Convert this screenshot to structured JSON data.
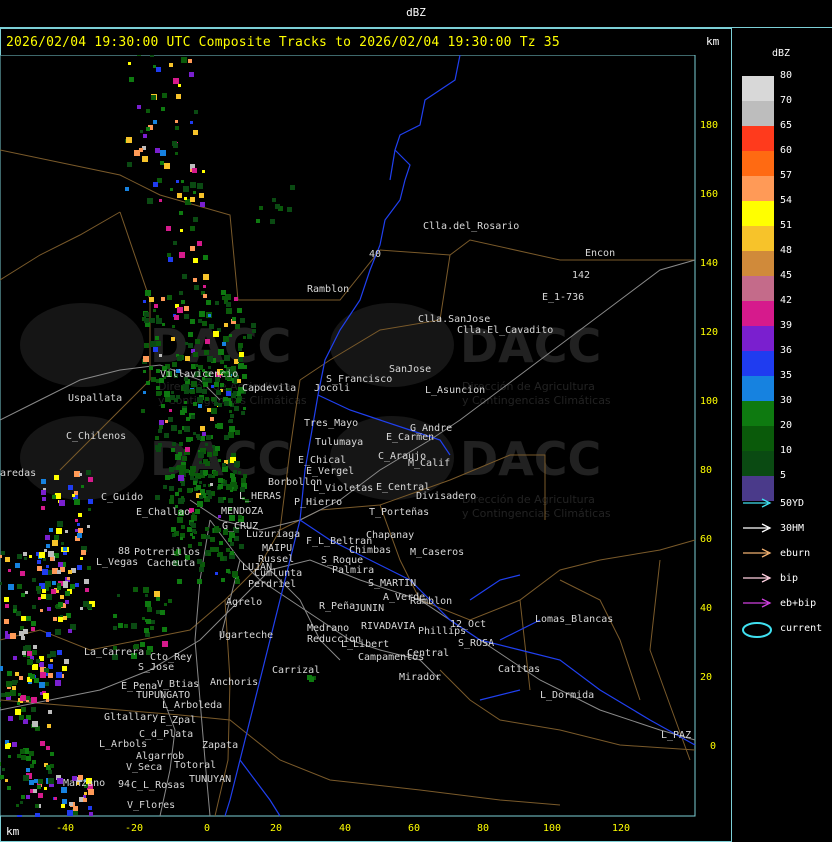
{
  "window": {
    "title": "dBZ"
  },
  "header": {
    "text": "2026/02/04 19:30:00 UTC Composite Tracks to 2026/02/04 19:30:00 Tz 35",
    "km_right": "km",
    "km_bottom": "km"
  },
  "axes": {
    "y_ticks": [
      "180",
      "160",
      "140",
      "120",
      "100",
      "80",
      "60",
      "40",
      "20",
      "0"
    ],
    "x_ticks": [
      "-40",
      "-20",
      "0",
      "20",
      "40",
      "60",
      "80",
      "100",
      "120"
    ]
  },
  "legend": {
    "title": "dBZ",
    "levels": [
      {
        "label": "80",
        "color": "#d8d8d8"
      },
      {
        "label": "70",
        "color": "#bdbdbd"
      },
      {
        "label": "65",
        "color": "#ff3a1c"
      },
      {
        "label": "60",
        "color": "#ff6a12"
      },
      {
        "label": "57",
        "color": "#ff9a57"
      },
      {
        "label": "54",
        "color": "#ffff00"
      },
      {
        "label": "51",
        "color": "#f7c32a"
      },
      {
        "label": "48",
        "color": "#d08a3a"
      },
      {
        "label": "45",
        "color": "#c46b8a"
      },
      {
        "label": "42",
        "color": "#d61a8c"
      },
      {
        "label": "39",
        "color": "#7a1fcf"
      },
      {
        "label": "36",
        "color": "#1f3cf0"
      },
      {
        "label": "35",
        "color": "#1682e0"
      },
      {
        "label": "30",
        "color": "#0e7a10"
      },
      {
        "label": "20",
        "color": "#0a5a0a"
      },
      {
        "label": "10",
        "color": "#0a4a12"
      },
      {
        "label": "5",
        "color": "#4a3a8a"
      }
    ],
    "tracks": [
      {
        "label": "50YD",
        "color": "#40e0f0"
      },
      {
        "label": "30HM",
        "color": "#ffffff"
      },
      {
        "label": "eburn",
        "color": "#f0b070"
      },
      {
        "label": "bip",
        "color": "#ffd0e0"
      },
      {
        "label": "eb+bip",
        "color": "#d040e0"
      },
      {
        "label": "current",
        "color": "#40e0f0"
      }
    ]
  },
  "watermark": {
    "brand": "DACC",
    "line1": "Dirección de Agricultura",
    "line2": "y Contingencias Climáticas"
  },
  "places": [
    {
      "name": "Clla.del_Rosario"
    },
    {
      "name": "Encon"
    },
    {
      "name": "142"
    },
    {
      "name": "E_1-736"
    },
    {
      "name": "Ramblon"
    },
    {
      "name": "Clla.SanJose"
    },
    {
      "name": "Clla.El_Cavadito"
    },
    {
      "name": "Villavicencio"
    },
    {
      "name": "Uspallata"
    },
    {
      "name": "Capdevila"
    },
    {
      "name": "Jocoli"
    },
    {
      "name": "S_Francisco"
    },
    {
      "name": "SanJose"
    },
    {
      "name": "L_Asuncion"
    },
    {
      "name": "C_Chilenos"
    },
    {
      "name": "Tres_Mayo"
    },
    {
      "name": "Tulumaya"
    },
    {
      "name": "G_Andre"
    },
    {
      "name": "E_Carmen"
    },
    {
      "name": "E_Chical"
    },
    {
      "name": "C_Araujo"
    },
    {
      "name": "M_Calif"
    },
    {
      "name": "E_Vergel"
    },
    {
      "name": "Borbollon"
    },
    {
      "name": "L_Violetas"
    },
    {
      "name": "E_Central"
    },
    {
      "name": "Divisadero"
    },
    {
      "name": "aredas"
    },
    {
      "name": "C_Guido"
    },
    {
      "name": "L_HERAS"
    },
    {
      "name": "P_Hierro"
    },
    {
      "name": "T_Porteñas"
    },
    {
      "name": "E_Challao"
    },
    {
      "name": "MENDOZA"
    },
    {
      "name": "G_CRUZ"
    },
    {
      "name": "Luzuriaga"
    },
    {
      "name": "Chapanay"
    },
    {
      "name": "F_L_Beltran"
    },
    {
      "name": "Chimbas"
    },
    {
      "name": "M_Caseros"
    },
    {
      "name": "88"
    },
    {
      "name": "Potrerillos"
    },
    {
      "name": "L_Vegas"
    },
    {
      "name": "Cacheuta"
    },
    {
      "name": "MAIPU"
    },
    {
      "name": "Russel"
    },
    {
      "name": "S_Roque"
    },
    {
      "name": "Palmira"
    },
    {
      "name": "LUJAN"
    },
    {
      "name": "Cumlunta"
    },
    {
      "name": "Perdriel"
    },
    {
      "name": "S_MARTIN"
    },
    {
      "name": "A_Verde"
    },
    {
      "name": "Agrelo"
    },
    {
      "name": "R_Peña"
    },
    {
      "name": "JUNIN"
    },
    {
      "name": "Ramblon"
    },
    {
      "name": "Lomas_Blancas"
    },
    {
      "name": "Ugarteche"
    },
    {
      "name": "Medrano"
    },
    {
      "name": "RIVADAVIA"
    },
    {
      "name": "Reduccion"
    },
    {
      "name": "Phillips"
    },
    {
      "name": "12_Oct"
    },
    {
      "name": "La_Carrera"
    },
    {
      "name": "Cto_Rey"
    },
    {
      "name": "L_Libert"
    },
    {
      "name": "S_ROSA"
    },
    {
      "name": "S_Jose"
    },
    {
      "name": "Carrizal"
    },
    {
      "name": "Campamentos"
    },
    {
      "name": "Central"
    },
    {
      "name": "Catitas"
    },
    {
      "name": "V_Btias"
    },
    {
      "name": "Anchoris"
    },
    {
      "name": "E_Pena"
    },
    {
      "name": "TUPUNGATO"
    },
    {
      "name": "Mirador"
    },
    {
      "name": "L_Dormida"
    },
    {
      "name": "L_Arboleda"
    },
    {
      "name": "Gltallary"
    },
    {
      "name": "E_Zpal"
    },
    {
      "name": "C_d_Plata"
    },
    {
      "name": "L_Arbols"
    },
    {
      "name": "Zapata"
    },
    {
      "name": "L_PAZ"
    },
    {
      "name": "Algarrob"
    },
    {
      "name": "Totoral"
    },
    {
      "name": "V_Seca"
    },
    {
      "name": "TUNUYAN"
    },
    {
      "name": "Manzano"
    },
    {
      "name": "94"
    },
    {
      "name": "C_L_Rosas"
    },
    {
      "name": "V_Flores"
    },
    {
      "name": "40"
    }
  ]
}
